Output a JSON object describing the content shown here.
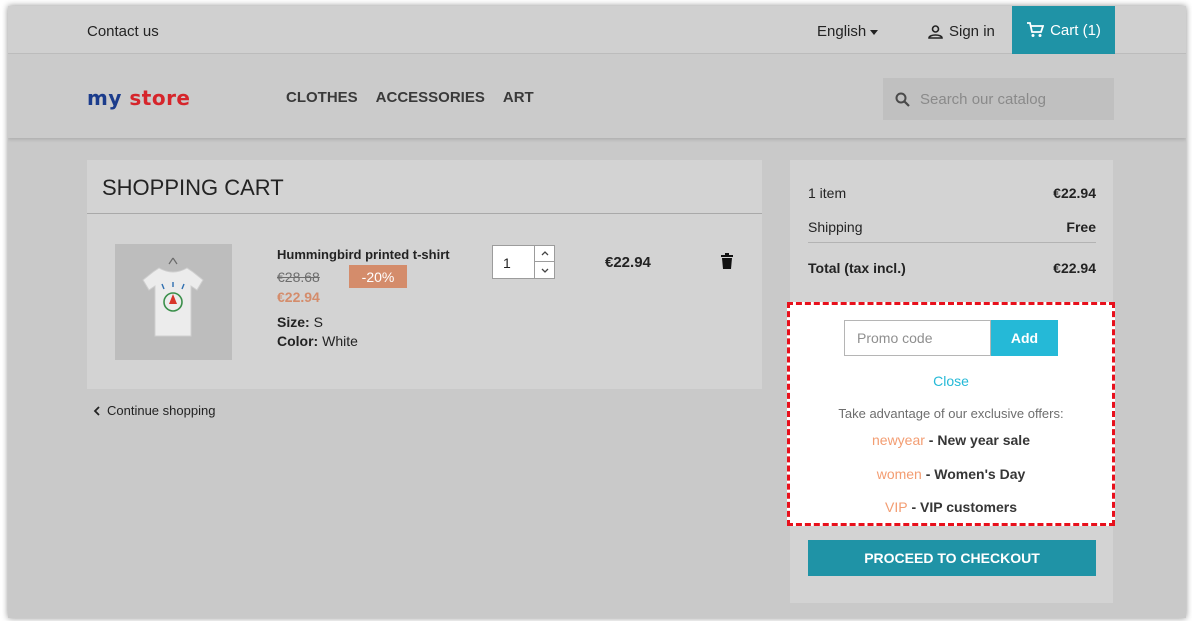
{
  "topbar": {
    "contact": "Contact us",
    "language": "English",
    "sign_in": "Sign in",
    "cart": "Cart (1)"
  },
  "header": {
    "logo": {
      "part1": "my",
      "part2": "store"
    },
    "nav": [
      "CLOTHES",
      "ACCESSORIES",
      "ART"
    ],
    "search_placeholder": "Search our catalog"
  },
  "cart": {
    "title": "SHOPPING CART",
    "item": {
      "name": "Hummingbird printed t-shirt",
      "old_price": "€28.68",
      "discount": "-20%",
      "price": "€22.94",
      "size_label": "Size:",
      "size_value": "S",
      "color_label": "Color:",
      "color_value": "White",
      "quantity": "1",
      "line_total": "€22.94"
    },
    "continue": "Continue shopping"
  },
  "summary": {
    "items_label": "1 item",
    "items_value": "€22.94",
    "shipping_label": "Shipping",
    "shipping_value": "Free",
    "total_label": "Total (tax incl.)",
    "total_value": "€22.94",
    "checkout": "PROCEED TO CHECKOUT"
  },
  "promo": {
    "placeholder": "Promo code",
    "add": "Add",
    "close": "Close",
    "intro": "Take advantage of our exclusive offers:",
    "offers": [
      {
        "code": "newyear",
        "desc": " - New year sale"
      },
      {
        "code": "women",
        "desc": " - Women's Day"
      },
      {
        "code": "VIP",
        "desc": " - VIP customers"
      }
    ]
  },
  "colors": {
    "accent": "#25b9d7",
    "cart_bg": "#1f93a6",
    "discount": "#d48c6b",
    "promo_code": "#f39d72",
    "highlight_border": "#e8101c"
  }
}
